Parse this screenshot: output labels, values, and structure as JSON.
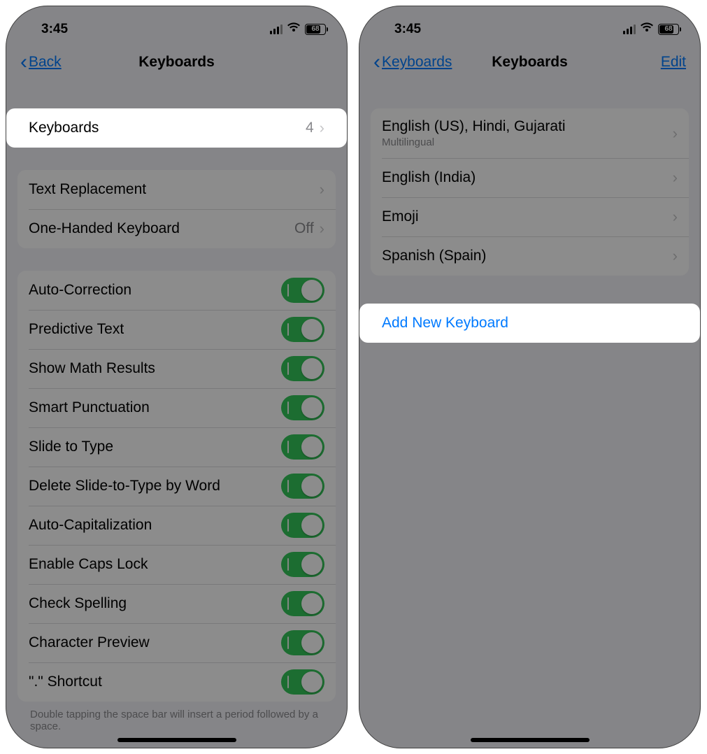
{
  "statusBar": {
    "time": "3:45",
    "battery": "68"
  },
  "screenLeft": {
    "nav": {
      "backLabel": "Back",
      "title": "Keyboards"
    },
    "keyboardsRow": {
      "label": "Keyboards",
      "count": "4"
    },
    "textReplacement": "Text Replacement",
    "oneHanded": {
      "label": "One-Handed Keyboard",
      "value": "Off"
    },
    "toggles": [
      "Auto-Correction",
      "Predictive Text",
      "Show Math Results",
      "Smart Punctuation",
      "Slide to Type",
      "Delete Slide-to-Type by Word",
      "Auto-Capitalization",
      "Enable Caps Lock",
      "Check Spelling",
      "Character Preview",
      "\".\" Shortcut"
    ],
    "footnote": "Double tapping the space bar will insert a period followed by a space."
  },
  "screenRight": {
    "nav": {
      "backLabel": "Keyboards",
      "title": "Keyboards",
      "editLabel": "Edit"
    },
    "keyboards": [
      {
        "title": "English (US), Hindi, Gujarati",
        "subtitle": "Multilingual"
      },
      {
        "title": "English (India)"
      },
      {
        "title": "Emoji"
      },
      {
        "title": "Spanish (Spain)"
      }
    ],
    "addNew": "Add New Keyboard"
  }
}
